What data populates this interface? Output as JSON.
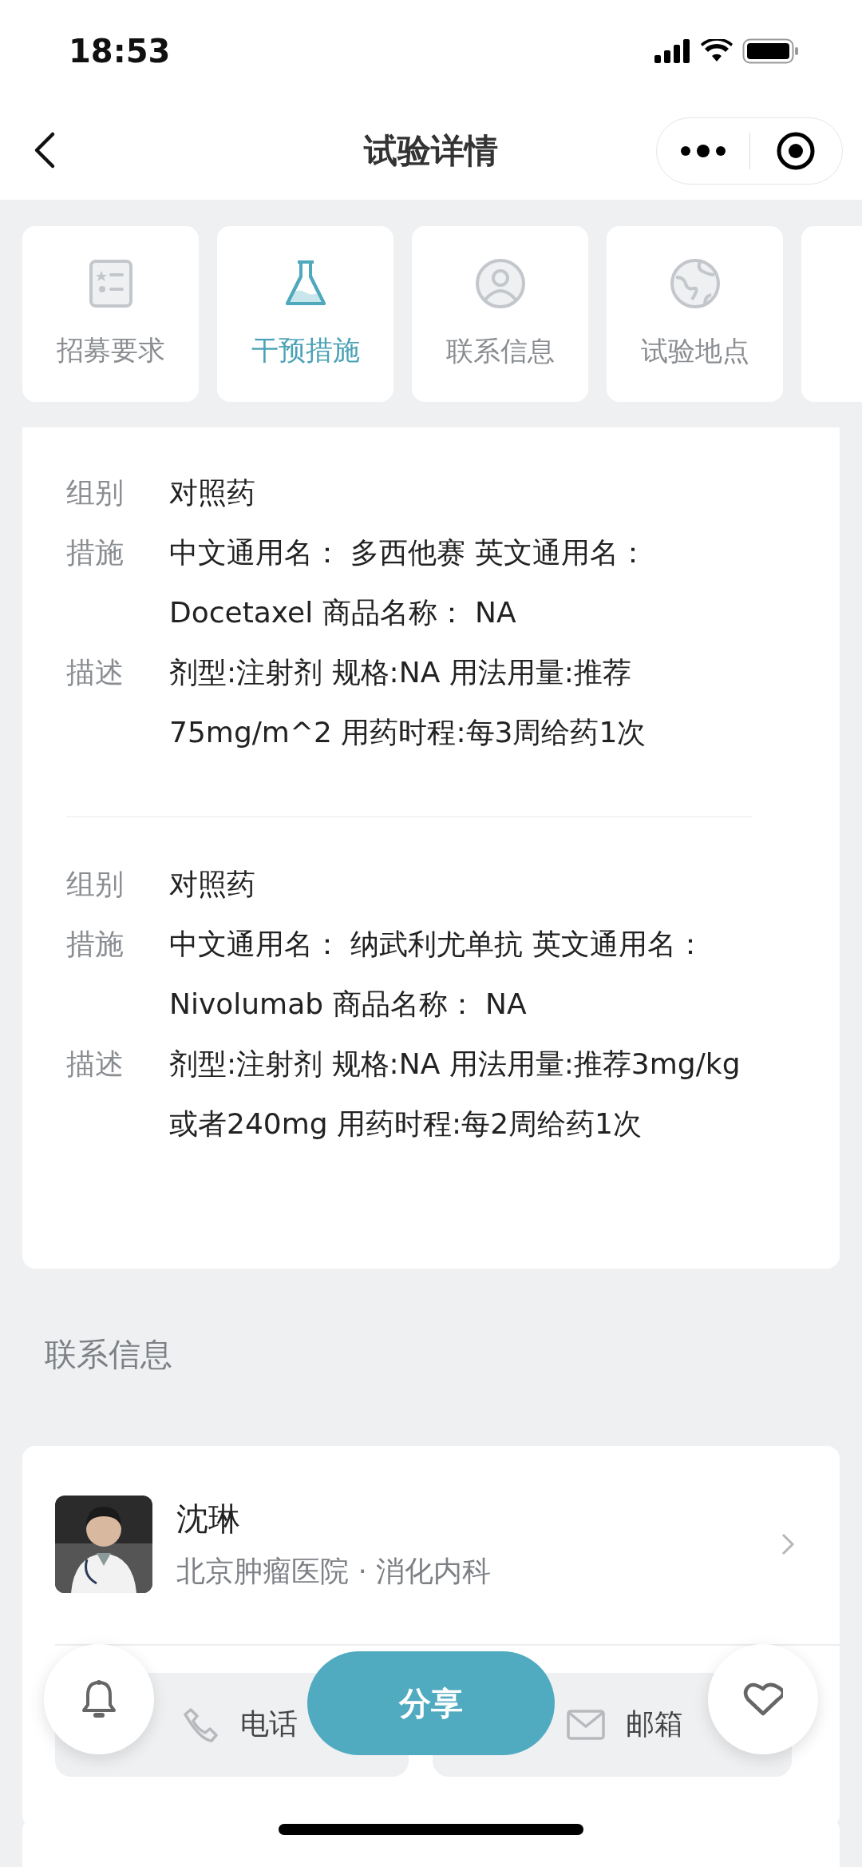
{
  "status_bar": {
    "time": "18:53"
  },
  "nav": {
    "title": "试验详情"
  },
  "tabs": [
    {
      "label": "招募要求",
      "selected": false
    },
    {
      "label": "干预措施",
      "selected": true
    },
    {
      "label": "联系信息",
      "selected": false
    },
    {
      "label": "试验地点",
      "selected": false
    }
  ],
  "interventions": [
    {
      "rows": [
        {
          "label": "组别",
          "value": "对照药"
        },
        {
          "label": "措施",
          "value": "中文通用名：  多西他赛  英文通用名：  Docetaxel  商品名称：  NA"
        },
        {
          "label": "描述",
          "value": "剂型:注射剂 规格:NA 用法用量:推荐75mg/m^2 用药时程:每3周给药1次"
        }
      ]
    },
    {
      "rows": [
        {
          "label": "组别",
          "value": "对照药"
        },
        {
          "label": "措施",
          "value": "中文通用名：  纳武利尤单抗  英文通用名：  Nivolumab  商品名称：  NA"
        },
        {
          "label": "描述",
          "value": "剂型:注射剂 规格:NA 用法用量:推荐3mg/kg或者240mg 用药时程:每2周给药1次"
        }
      ]
    }
  ],
  "contact_section": {
    "title": "联系信息",
    "contact": {
      "name": "沈琳",
      "affiliation": "北京肿瘤医院 · 消化内科"
    },
    "actions": [
      {
        "label": "电话"
      },
      {
        "label": "邮箱"
      }
    ]
  },
  "bottom_bar": {
    "share": "分享"
  }
}
